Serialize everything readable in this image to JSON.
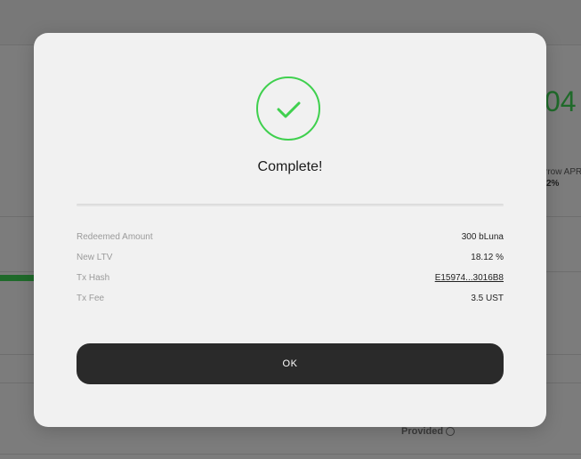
{
  "background": {
    "big_number": "04",
    "apr_label": "rrow APR",
    "apr_value": "2%",
    "provided_label": "Provided"
  },
  "modal": {
    "icon": "check-icon",
    "title": "Complete!",
    "details": [
      {
        "label": "Redeemed Amount",
        "value": "300 bLuna"
      },
      {
        "label": "New LTV",
        "value": "18.12 %"
      },
      {
        "label": "Tx Hash",
        "value": "E15974...3016B8"
      },
      {
        "label": "Tx Fee",
        "value": "3.5 UST"
      }
    ],
    "ok_label": "OK"
  },
  "colors": {
    "success": "#3fd04e",
    "button_bg": "#2a2a2a",
    "modal_bg": "#f1f1f1"
  }
}
